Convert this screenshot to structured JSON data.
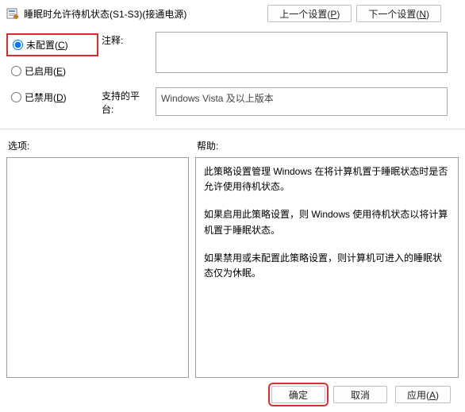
{
  "title": "睡眠时允许待机状态(S1-S3)(接通电源)",
  "nav": {
    "prev": "上一个设置(",
    "prev_key": "P",
    "next": "下一个设置(",
    "next_key": "N",
    "close_paren": ")"
  },
  "radios": {
    "not_configured": "未配置(",
    "not_configured_key": "C",
    "enabled": "已启用(",
    "enabled_key": "E",
    "disabled": "已禁用(",
    "disabled_key": "D"
  },
  "labels": {
    "comment": "注释:",
    "supported": "支持的平台:",
    "options": "选项:",
    "help": "帮助:"
  },
  "platform": "Windows Vista 及以上版本",
  "help": {
    "p1": "此策略设置管理 Windows 在将计算机置于睡眠状态时是否允许使用待机状态。",
    "p2": "如果启用此策略设置，则 Windows 使用待机状态以将计算机置于睡眠状态。",
    "p3": "如果禁用或未配置此策略设置，则计算机可进入的睡眠状态仅为休眠。"
  },
  "footer": {
    "ok": "确定",
    "cancel": "取消",
    "apply": "应用(",
    "apply_key": "A"
  }
}
